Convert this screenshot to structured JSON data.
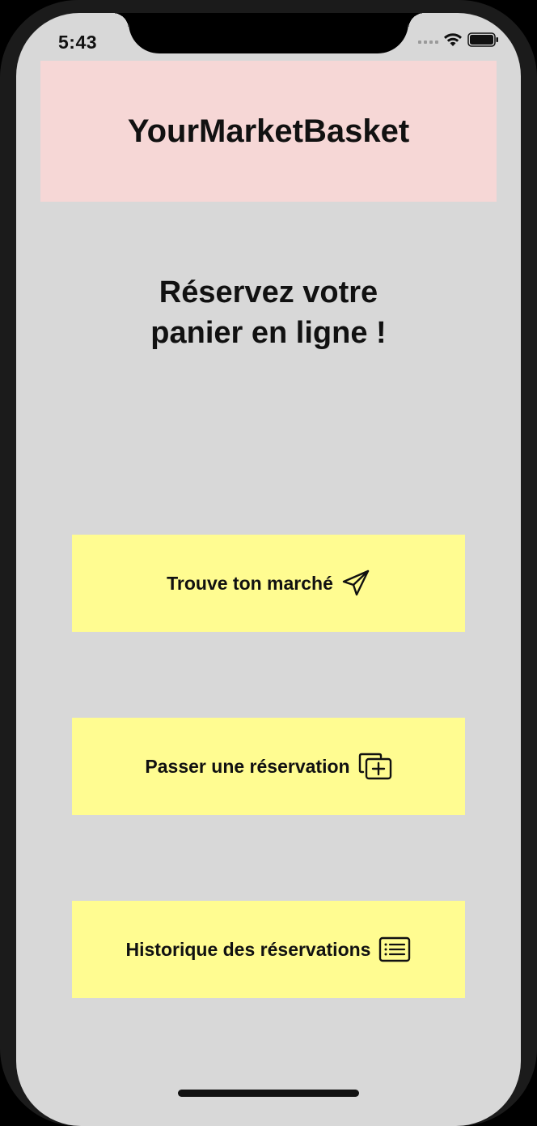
{
  "status_bar": {
    "time": "5:43",
    "icons": [
      "cellular-signal-icon",
      "wifi-icon",
      "battery-icon"
    ]
  },
  "header": {
    "title": "YourMarketBasket",
    "background": "#f6d7d6"
  },
  "hero": {
    "line1": "Réservez votre",
    "line2": "panier en ligne !"
  },
  "actions": [
    {
      "label": "Trouve ton marché",
      "icon": "paper-plane-icon"
    },
    {
      "label": "Passer une réservation",
      "icon": "add-stack-icon"
    },
    {
      "label": "Historique des réservations",
      "icon": "list-icon"
    }
  ],
  "colors": {
    "screen_background": "#d8d8d8",
    "button_background": "#fffc91",
    "text": "#111111"
  }
}
